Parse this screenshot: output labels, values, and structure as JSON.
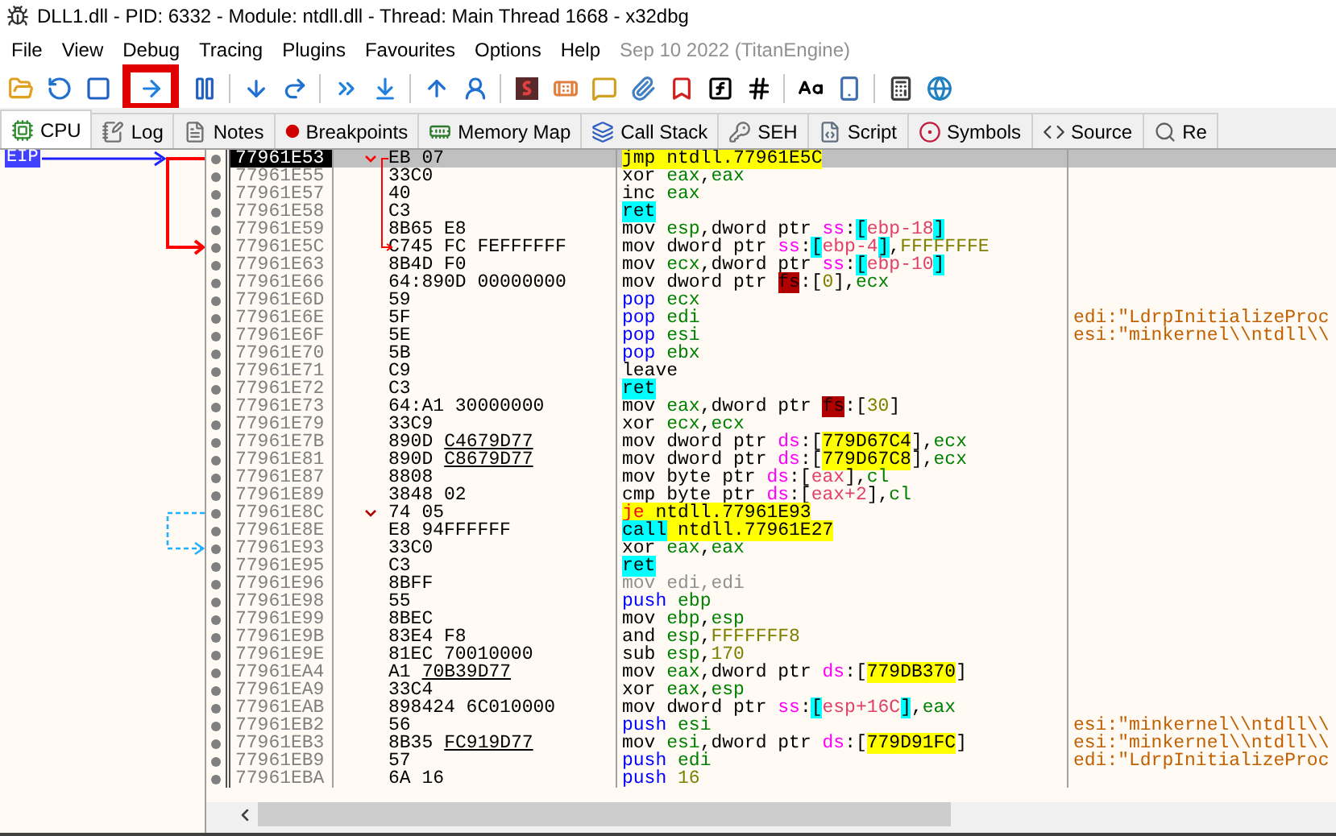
{
  "window": {
    "title": "DLL1.dll - PID: 6332 - Module: ntdll.dll - Thread: Main Thread 1668 - x32dbg"
  },
  "menu": [
    "File",
    "View",
    "Debug",
    "Tracing",
    "Plugins",
    "Favourites",
    "Options",
    "Help"
  ],
  "build_info": "Sep 10 2022 (TitanEngine)",
  "tabs": [
    {
      "label": "CPU",
      "kind": "cpu",
      "selected": true
    },
    {
      "label": "Log",
      "kind": "log",
      "selected": false
    },
    {
      "label": "Notes",
      "kind": "notes",
      "selected": false
    },
    {
      "label": "Breakpoints",
      "kind": "breakpoints",
      "selected": false
    },
    {
      "label": "Memory Map",
      "kind": "memory",
      "selected": false
    },
    {
      "label": "Call Stack",
      "kind": "callstack",
      "selected": false
    },
    {
      "label": "SEH",
      "kind": "seh",
      "selected": false
    },
    {
      "label": "Script",
      "kind": "script",
      "selected": false
    },
    {
      "label": "Symbols",
      "kind": "symbols",
      "selected": false
    },
    {
      "label": "Source",
      "kind": "source",
      "selected": false
    },
    {
      "label": "Re",
      "kind": "references",
      "selected": false
    }
  ],
  "disassembly": {
    "rows": [
      {
        "address": "77961E53",
        "bytes": "EB 07",
        "selected": true,
        "marker": "EIP",
        "kind": "jump-from",
        "ins": [
          {
            "text": "jmp",
            "kind": "jmp"
          },
          {
            "text": " ntdll.77961E5C",
            "kind": "addr"
          }
        ]
      },
      {
        "address": "77961E55",
        "bytes": "33C0",
        "selected": false,
        "kind": "plain",
        "ins": [
          {
            "text": "xor",
            "kind": "op"
          },
          {
            "text": " eax",
            "kind": "reg"
          },
          {
            "text": ",",
            "kind": "p"
          },
          {
            "text": "eax",
            "kind": "reg"
          }
        ]
      },
      {
        "address": "77961E57",
        "bytes": "40",
        "selected": false,
        "kind": "plain",
        "ins": [
          {
            "text": "inc",
            "kind": "op"
          },
          {
            "text": " eax",
            "kind": "reg"
          }
        ]
      },
      {
        "address": "77961E58",
        "bytes": "C3",
        "selected": false,
        "kind": "plain",
        "ins": [
          {
            "text": "ret",
            "kind": "ret"
          }
        ]
      },
      {
        "address": "77961E59",
        "bytes": "8B65 E8",
        "selected": false,
        "kind": "plain",
        "ins": [
          {
            "text": "mov",
            "kind": "op"
          },
          {
            "text": " esp",
            "kind": "reg"
          },
          {
            "text": ",dword ptr ",
            "kind": "p"
          },
          {
            "text": "ss",
            "kind": "seg"
          },
          {
            "text": ":",
            "kind": "p"
          },
          {
            "text": "[",
            "kind": "brh"
          },
          {
            "text": "ebp-18",
            "kind": "mem"
          },
          {
            "text": "]",
            "kind": "brh"
          }
        ]
      },
      {
        "address": "77961E5C",
        "bytes": "C745 FC FEFFFFFF",
        "selected": false,
        "kind": "jump-to",
        "ins": [
          {
            "text": "mov dword ptr ",
            "kind": "op"
          },
          {
            "text": "ss",
            "kind": "seg"
          },
          {
            "text": ":",
            "kind": "p"
          },
          {
            "text": "[",
            "kind": "brh"
          },
          {
            "text": "ebp-4",
            "kind": "mem"
          },
          {
            "text": "]",
            "kind": "brh"
          },
          {
            "text": ",",
            "kind": "p"
          },
          {
            "text": "FFFFFFFE",
            "kind": "num"
          }
        ]
      },
      {
        "address": "77961E63",
        "bytes": "8B4D F0",
        "selected": false,
        "kind": "plain",
        "ins": [
          {
            "text": "mov",
            "kind": "op"
          },
          {
            "text": " ecx",
            "kind": "reg"
          },
          {
            "text": ",dword ptr ",
            "kind": "p"
          },
          {
            "text": "ss",
            "kind": "seg"
          },
          {
            "text": ":",
            "kind": "p"
          },
          {
            "text": "[",
            "kind": "brh"
          },
          {
            "text": "ebp-10",
            "kind": "mem"
          },
          {
            "text": "]",
            "kind": "brh"
          }
        ]
      },
      {
        "address": "77961E66",
        "bytes": "64:890D 00000000",
        "selected": false,
        "kind": "plain",
        "ins": [
          {
            "text": "mov dword ptr ",
            "kind": "op"
          },
          {
            "text": "fs",
            "kind": "fs"
          },
          {
            "text": ":[",
            "kind": "p"
          },
          {
            "text": "0",
            "kind": "num"
          },
          {
            "text": "],",
            "kind": "p"
          },
          {
            "text": "ecx",
            "kind": "reg"
          }
        ]
      },
      {
        "address": "77961E6D",
        "bytes": "59",
        "selected": false,
        "kind": "plain",
        "ins": [
          {
            "text": "pop",
            "kind": "stack"
          },
          {
            "text": " ecx",
            "kind": "reg"
          }
        ]
      },
      {
        "address": "77961E6E",
        "bytes": "5F",
        "selected": false,
        "kind": "plain",
        "comment": "edi:\"LdrpInitializeProc",
        "ins": [
          {
            "text": "pop",
            "kind": "stack"
          },
          {
            "text": " edi",
            "kind": "reg"
          }
        ]
      },
      {
        "address": "77961E6F",
        "bytes": "5E",
        "selected": false,
        "kind": "plain",
        "comment": "esi:\"minkernel\\\\ntdll\\\\",
        "ins": [
          {
            "text": "pop",
            "kind": "stack"
          },
          {
            "text": " esi",
            "kind": "reg"
          }
        ]
      },
      {
        "address": "77961E70",
        "bytes": "5B",
        "selected": false,
        "kind": "plain",
        "ins": [
          {
            "text": "pop",
            "kind": "stack"
          },
          {
            "text": " ebx",
            "kind": "reg"
          }
        ]
      },
      {
        "address": "77961E71",
        "bytes": "C9",
        "selected": false,
        "kind": "plain",
        "ins": [
          {
            "text": "leave",
            "kind": "op"
          }
        ]
      },
      {
        "address": "77961E72",
        "bytes": "C3",
        "selected": false,
        "kind": "plain",
        "ins": [
          {
            "text": "ret",
            "kind": "ret"
          }
        ]
      },
      {
        "address": "77961E73",
        "bytes": "64:A1 30000000",
        "selected": false,
        "kind": "plain",
        "ins": [
          {
            "text": "mov",
            "kind": "op"
          },
          {
            "text": " eax",
            "kind": "reg"
          },
          {
            "text": ",dword ptr ",
            "kind": "p"
          },
          {
            "text": "fs",
            "kind": "fs"
          },
          {
            "text": ":[",
            "kind": "p"
          },
          {
            "text": "30",
            "kind": "num"
          },
          {
            "text": "]",
            "kind": "p"
          }
        ]
      },
      {
        "address": "77961E79",
        "bytes": "33C9",
        "selected": false,
        "kind": "plain",
        "ins": [
          {
            "text": "xor",
            "kind": "op"
          },
          {
            "text": " ecx",
            "kind": "reg"
          },
          {
            "text": ",",
            "kind": "p"
          },
          {
            "text": "ecx",
            "kind": "reg"
          }
        ]
      },
      {
        "address": "77961E7B",
        "bytes": "890D",
        "bytes_ref": "C4679D77",
        "selected": false,
        "kind": "plain",
        "ins": [
          {
            "text": "mov dword ptr ",
            "kind": "op"
          },
          {
            "text": "ds",
            "kind": "seg"
          },
          {
            "text": ":[",
            "kind": "p"
          },
          {
            "text": "779D67C4",
            "kind": "addr"
          },
          {
            "text": "],",
            "kind": "p"
          },
          {
            "text": "ecx",
            "kind": "reg"
          }
        ]
      },
      {
        "address": "77961E81",
        "bytes": "890D",
        "bytes_ref": "C8679D77",
        "selected": false,
        "kind": "plain",
        "ins": [
          {
            "text": "mov dword ptr ",
            "kind": "op"
          },
          {
            "text": "ds",
            "kind": "seg"
          },
          {
            "text": ":[",
            "kind": "p"
          },
          {
            "text": "779D67C8",
            "kind": "addr"
          },
          {
            "text": "],",
            "kind": "p"
          },
          {
            "text": "ecx",
            "kind": "reg"
          }
        ]
      },
      {
        "address": "77961E87",
        "bytes": "8808",
        "selected": false,
        "kind": "plain",
        "ins": [
          {
            "text": "mov byte ptr ",
            "kind": "op"
          },
          {
            "text": "ds",
            "kind": "seg"
          },
          {
            "text": ":[",
            "kind": "p"
          },
          {
            "text": "eax",
            "kind": "mem"
          },
          {
            "text": "],",
            "kind": "p"
          },
          {
            "text": "cl",
            "kind": "reg"
          }
        ]
      },
      {
        "address": "77961E89",
        "bytes": "3848 02",
        "selected": false,
        "kind": "plain",
        "ins": [
          {
            "text": "cmp byte ptr ",
            "kind": "op"
          },
          {
            "text": "ds",
            "kind": "seg"
          },
          {
            "text": ":[",
            "kind": "p"
          },
          {
            "text": "eax+2",
            "kind": "mem"
          },
          {
            "text": "],",
            "kind": "p"
          },
          {
            "text": "cl",
            "kind": "reg"
          }
        ]
      },
      {
        "address": "77961E8C",
        "bytes": "74 05",
        "selected": false,
        "kind": "cond-from",
        "ins": [
          {
            "text": "je",
            "kind": "jcc"
          },
          {
            "text": " ntdll.77961E93",
            "kind": "addr"
          }
        ]
      },
      {
        "address": "77961E8E",
        "bytes": "E8 94FFFFFF",
        "selected": false,
        "kind": "plain",
        "ins": [
          {
            "text": "call",
            "kind": "call"
          },
          {
            "text": " ntdll.77961E27",
            "kind": "addr"
          }
        ]
      },
      {
        "address": "77961E93",
        "bytes": "33C0",
        "selected": false,
        "kind": "cond-to",
        "ins": [
          {
            "text": "xor",
            "kind": "op"
          },
          {
            "text": " eax",
            "kind": "reg"
          },
          {
            "text": ",",
            "kind": "p"
          },
          {
            "text": "eax",
            "kind": "reg"
          }
        ]
      },
      {
        "address": "77961E95",
        "bytes": "C3",
        "selected": false,
        "kind": "plain",
        "ins": [
          {
            "text": "ret",
            "kind": "ret"
          }
        ]
      },
      {
        "address": "77961E96",
        "bytes": "8BFF",
        "selected": false,
        "kind": "plain",
        "ins": [
          {
            "text": "mov edi,edi",
            "kind": "dim"
          }
        ]
      },
      {
        "address": "77961E98",
        "bytes": "55",
        "selected": false,
        "kind": "plain",
        "ins": [
          {
            "text": "push",
            "kind": "stack"
          },
          {
            "text": " ebp",
            "kind": "reg"
          }
        ]
      },
      {
        "address": "77961E99",
        "bytes": "8BEC",
        "selected": false,
        "kind": "plain",
        "ins": [
          {
            "text": "mov",
            "kind": "op"
          },
          {
            "text": " ebp",
            "kind": "reg"
          },
          {
            "text": ",",
            "kind": "p"
          },
          {
            "text": "esp",
            "kind": "reg"
          }
        ]
      },
      {
        "address": "77961E9B",
        "bytes": "83E4 F8",
        "selected": false,
        "kind": "plain",
        "ins": [
          {
            "text": "and",
            "kind": "op"
          },
          {
            "text": " esp",
            "kind": "reg"
          },
          {
            "text": ",",
            "kind": "p"
          },
          {
            "text": "FFFFFFF8",
            "kind": "num"
          }
        ]
      },
      {
        "address": "77961E9E",
        "bytes": "81EC 70010000",
        "selected": false,
        "kind": "plain",
        "ins": [
          {
            "text": "sub",
            "kind": "op"
          },
          {
            "text": " esp",
            "kind": "reg"
          },
          {
            "text": ",",
            "kind": "p"
          },
          {
            "text": "170",
            "kind": "num"
          }
        ]
      },
      {
        "address": "77961EA4",
        "bytes": "A1",
        "bytes_ref": "70B39D77",
        "selected": false,
        "kind": "plain",
        "ins": [
          {
            "text": "mov",
            "kind": "op"
          },
          {
            "text": " eax",
            "kind": "reg"
          },
          {
            "text": ",dword ptr ",
            "kind": "p"
          },
          {
            "text": "ds",
            "kind": "seg"
          },
          {
            "text": ":[",
            "kind": "p"
          },
          {
            "text": "779DB370",
            "kind": "addr"
          },
          {
            "text": "]",
            "kind": "p"
          }
        ]
      },
      {
        "address": "77961EA9",
        "bytes": "33C4",
        "selected": false,
        "kind": "plain",
        "ins": [
          {
            "text": "xor",
            "kind": "op"
          },
          {
            "text": " eax",
            "kind": "reg"
          },
          {
            "text": ",",
            "kind": "p"
          },
          {
            "text": "esp",
            "kind": "reg"
          }
        ]
      },
      {
        "address": "77961EAB",
        "bytes": "898424 6C010000",
        "selected": false,
        "kind": "plain",
        "ins": [
          {
            "text": "mov dword ptr ",
            "kind": "op"
          },
          {
            "text": "ss",
            "kind": "seg"
          },
          {
            "text": ":",
            "kind": "p"
          },
          {
            "text": "[",
            "kind": "brh"
          },
          {
            "text": "esp+16C",
            "kind": "mem"
          },
          {
            "text": "]",
            "kind": "brh"
          },
          {
            "text": ",",
            "kind": "p"
          },
          {
            "text": "eax",
            "kind": "reg"
          }
        ]
      },
      {
        "address": "77961EB2",
        "bytes": "56",
        "selected": false,
        "kind": "plain",
        "comment": "esi:\"minkernel\\\\ntdll\\\\",
        "ins": [
          {
            "text": "push",
            "kind": "stack"
          },
          {
            "text": " esi",
            "kind": "reg"
          }
        ]
      },
      {
        "address": "77961EB3",
        "bytes": "8B35",
        "bytes_ref": "FC919D77",
        "selected": false,
        "kind": "plain",
        "comment": "esi:\"minkernel\\\\ntdll\\\\",
        "ins": [
          {
            "text": "mov",
            "kind": "op"
          },
          {
            "text": " esi",
            "kind": "reg"
          },
          {
            "text": ",dword ptr ",
            "kind": "p"
          },
          {
            "text": "ds",
            "kind": "seg"
          },
          {
            "text": ":[",
            "kind": "p"
          },
          {
            "text": "779D91FC",
            "kind": "addr"
          },
          {
            "text": "]",
            "kind": "p"
          }
        ]
      },
      {
        "address": "77961EB9",
        "bytes": "57",
        "selected": false,
        "kind": "plain",
        "comment": "edi:\"LdrpInitializeProc",
        "ins": [
          {
            "text": "push",
            "kind": "stack"
          },
          {
            "text": " edi",
            "kind": "reg"
          }
        ]
      },
      {
        "address": "77961EBA",
        "bytes": "6A 16",
        "selected": false,
        "kind": "plain",
        "ins": [
          {
            "text": "push",
            "kind": "stack"
          },
          {
            "text": " 16",
            "kind": "num"
          }
        ]
      }
    ]
  }
}
